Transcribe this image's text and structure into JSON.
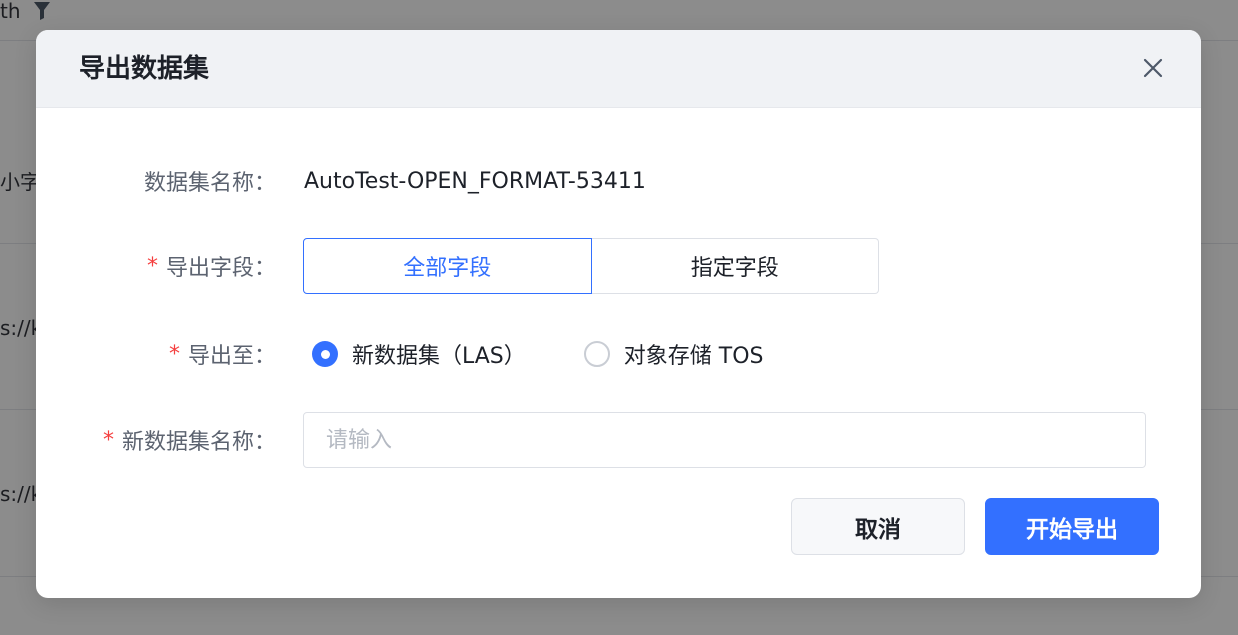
{
  "background": {
    "header_text": "th",
    "row_texts": [
      "小字",
      "s://k",
      "s://k"
    ]
  },
  "modal": {
    "title": "导出数据集",
    "fields": {
      "dataset_name": {
        "label": "数据集名称：",
        "value": "AutoTest-OPEN_FORMAT-53411"
      },
      "export_fields": {
        "label": "导出字段：",
        "required": true,
        "options": [
          "全部字段",
          "指定字段"
        ],
        "selected": "全部字段"
      },
      "export_to": {
        "label": "导出至：",
        "required": true,
        "options": [
          "新数据集（LAS）",
          "对象存储 TOS"
        ],
        "selected": "新数据集（LAS）"
      },
      "new_dataset_name": {
        "label": "新数据集名称：",
        "required": true,
        "value": "",
        "placeholder": "请输入"
      }
    },
    "buttons": {
      "cancel": "取消",
      "submit": "开始导出"
    }
  },
  "colors": {
    "primary": "#3370ff",
    "required": "#f53f3f",
    "mask": "rgba(0,0,0,0.45)"
  }
}
